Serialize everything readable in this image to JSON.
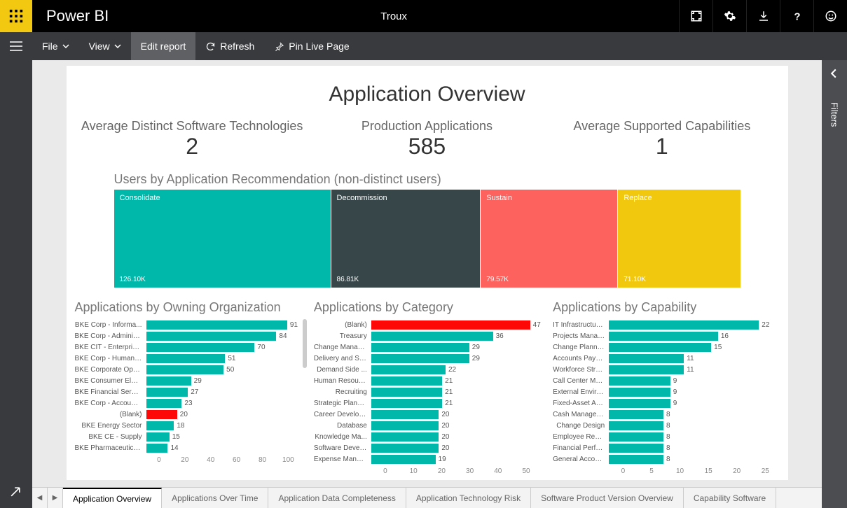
{
  "app": {
    "name": "Power BI",
    "workspace": "Troux"
  },
  "commandbar": {
    "file": "File",
    "view": "View",
    "edit": "Edit report",
    "refresh": "Refresh",
    "pin": "Pin Live Page"
  },
  "rail": {
    "filters": "Filters"
  },
  "report": {
    "title": "Application Overview",
    "kpis": [
      {
        "label": "Average Distinct Software Technologies",
        "value": "2"
      },
      {
        "label": "Production Applications",
        "value": "585"
      },
      {
        "label": "Average Supported Capabilities",
        "value": "1"
      }
    ]
  },
  "treemap": {
    "title": "Users by Application Recommendation (non-distinct users)",
    "cells": [
      {
        "name": "Consolidate",
        "value": "126.10K",
        "color": "#00b8aa",
        "weight": 126.1
      },
      {
        "name": "Decommission",
        "value": "86.81K",
        "color": "#374649",
        "weight": 86.81
      },
      {
        "name": "Sustain",
        "value": "79.57K",
        "color": "#fd625e",
        "weight": 79.57
      },
      {
        "name": "Replace",
        "value": "71.10K",
        "color": "#f2c80f",
        "weight": 71.1
      }
    ]
  },
  "chart_data": [
    {
      "type": "bar",
      "title": "Applications by Owning Organization",
      "label_width": 102,
      "xmax": 100,
      "ticks": [
        "0",
        "20",
        "40",
        "60",
        "80",
        "100"
      ],
      "categories": [
        "BKE Corp - Informa...",
        "BKE Corp - Adminis...",
        "BKE CIT - Enterprise...",
        "BKE Corp - Human ...",
        "BKE Corporate Ope...",
        "BKE Consumer Elec...",
        "BKE Financial Servic...",
        "BKE Corp - Account...",
        "(Blank)",
        "BKE Energy Sector",
        "BKE CE - Supply",
        "BKE Pharmaceuticals"
      ],
      "values": [
        91,
        84,
        70,
        51,
        50,
        29,
        27,
        23,
        20,
        18,
        15,
        14
      ],
      "highlight_index": 8
    },
    {
      "type": "bar",
      "title": "Applications by Category",
      "label_width": 82,
      "xmax": 50,
      "ticks": [
        "0",
        "10",
        "20",
        "30",
        "40",
        "50"
      ],
      "categories": [
        "(Blank)",
        "Treasury",
        "Change Manag...",
        "Delivery and Su...",
        "Demand Side ...",
        "Human Resourc...",
        "Recruiting",
        "Strategic Planni...",
        "Career Develop...",
        "Database",
        "Knowledge Ma...",
        "Software Devel...",
        "Expense Manag..."
      ],
      "values": [
        47,
        36,
        29,
        29,
        22,
        21,
        21,
        21,
        20,
        20,
        20,
        20,
        19
      ],
      "highlight_index": 0
    },
    {
      "type": "bar",
      "title": "Applications by Capability",
      "label_width": 80,
      "xmax": 25,
      "ticks": [
        "0",
        "5",
        "10",
        "15",
        "20",
        "25"
      ],
      "categories": [
        "IT Infrastructure...",
        "Projects Manag...",
        "Change Planning",
        "Accounts Payabl...",
        "Workforce Strat...",
        "Call Center Man...",
        "External Environ...",
        "Fixed-Asset Acc...",
        "Cash Managem...",
        "Change Design",
        "Employee Requi...",
        "Financial Perfor...",
        "General Accoun..."
      ],
      "values": [
        22,
        16,
        15,
        11,
        11,
        9,
        9,
        9,
        8,
        8,
        8,
        8,
        8
      ]
    }
  ],
  "tabs": [
    "Application Overview",
    "Applications Over Time",
    "Application Data Completeness",
    "Application Technology Risk",
    "Software Product Version Overview",
    "Capability Software"
  ],
  "active_tab": 0
}
